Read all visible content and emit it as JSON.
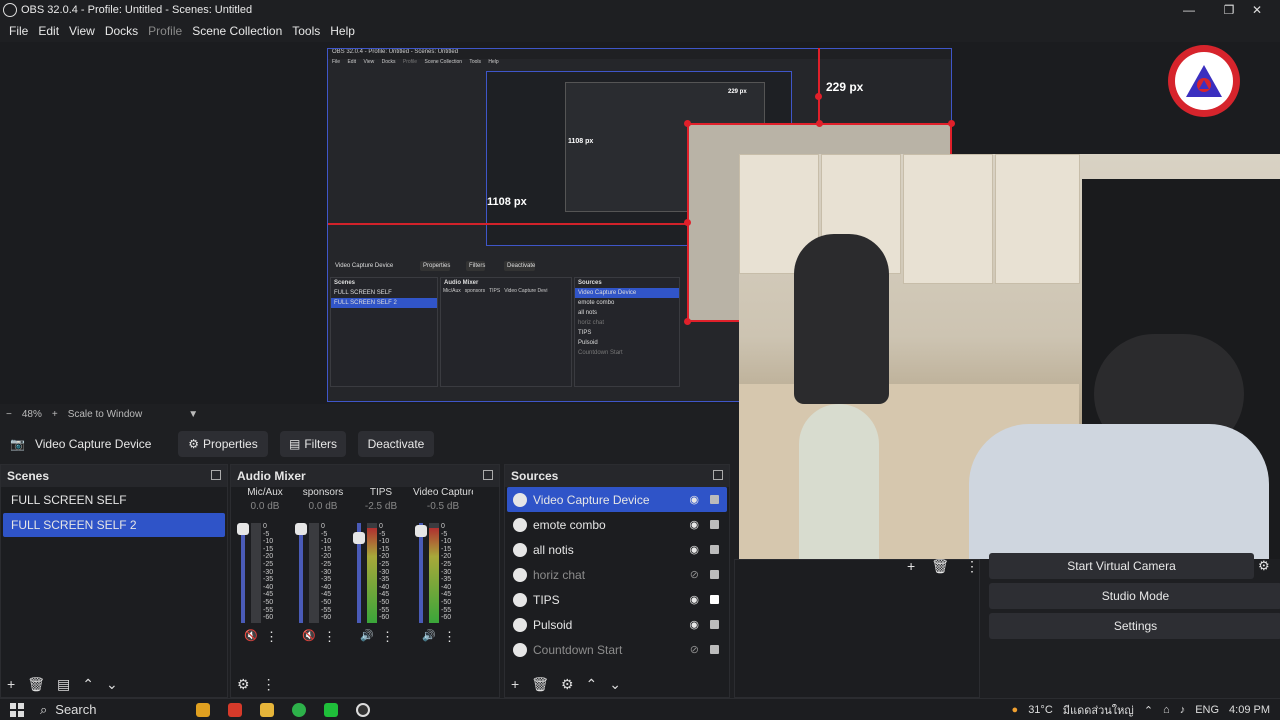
{
  "window": {
    "title": "OBS 32.0.4 - Profile: Untitled - Scenes: Untitled",
    "minimize": "—",
    "restore": "❐",
    "close": "✕"
  },
  "menu": [
    "File",
    "Edit",
    "View",
    "Docks",
    "Profile",
    "Scene Collection",
    "Tools",
    "Help"
  ],
  "preview": {
    "nested_title": "OBS 32.0.4 - Profile: Untitled - Scenes: Untitled",
    "nested_menu": [
      "File",
      "Edit",
      "View",
      "Docks",
      "Profile",
      "Scene Collection",
      "Tools",
      "Help"
    ],
    "measure_top": "229 px",
    "measure_left": "1108 px",
    "measure_inner_top": "229 px",
    "measure_inner_left": "1108 px",
    "nested_source_name": "Video Capture Device",
    "nested_buttons": [
      "Properties",
      "Filters",
      "Deactivate"
    ],
    "nested_scenes_title": "Scenes",
    "nested_scenes": [
      "FULL SCREEN SELF",
      "FULL SCREEN SELF 2"
    ],
    "nested_audio_title": "Audio Mixer",
    "nested_audio": [
      "Mic/Aux",
      "sponsors",
      "TIPS",
      "Video Capture Devi"
    ],
    "nested_sources_title": "Sources",
    "nested_sources": [
      "Video Capture Device",
      "emote combo",
      "all nots",
      "horiz chat",
      "TIPS",
      "Pulsoid",
      "Countdown Start"
    ]
  },
  "zoom": {
    "minus": "−",
    "value": "48%",
    "plus": "+",
    "mode": "Scale to Window"
  },
  "source_toolbar": {
    "name": "Video Capture Device",
    "properties": "Properties",
    "filters": "Filters",
    "deactivate": "Deactivate"
  },
  "scenes": {
    "title": "Scenes",
    "items": [
      "FULL SCREEN SELF",
      "FULL SCREEN SELF 2"
    ],
    "selected": 1
  },
  "audio_mixer": {
    "title": "Audio Mixer",
    "channels": [
      {
        "name": "Mic/Aux",
        "db": "0.0 dB",
        "fader_level": 1.0,
        "meter_level": 0.0,
        "muted": true
      },
      {
        "name": "sponsors",
        "db": "0.0 dB",
        "fader_level": 1.0,
        "meter_level": 0.0,
        "muted": true
      },
      {
        "name": "TIPS",
        "db": "-2.5 dB",
        "fader_level": 0.9,
        "meter_level": 0.95,
        "muted": false
      },
      {
        "name": "Video Capture Devi",
        "db": "-0.5 dB",
        "fader_level": 0.98,
        "meter_level": 0.95,
        "muted": false
      }
    ],
    "scale": [
      "0",
      "-5",
      "-10",
      "-15",
      "-20",
      "-25",
      "-30",
      "-35",
      "-40",
      "-45",
      "-50",
      "-55",
      "-60"
    ]
  },
  "sources": {
    "title": "Sources",
    "items": [
      {
        "name": "Video Capture Device",
        "visible": true,
        "locked": false
      },
      {
        "name": "emote combo",
        "visible": true,
        "locked": false
      },
      {
        "name": "all notis",
        "visible": true,
        "locked": false
      },
      {
        "name": "horiz chat",
        "visible": false,
        "locked": false
      },
      {
        "name": "TIPS",
        "visible": true,
        "locked": true
      },
      {
        "name": "Pulsoid",
        "visible": true,
        "locked": false
      },
      {
        "name": "Countdown Start",
        "visible": false,
        "locked": false
      }
    ],
    "selected": 0
  },
  "controls": {
    "virtual_camera": "Start Virtual Camera",
    "studio_mode": "Studio Mode",
    "settings": "Settings"
  },
  "taskbar": {
    "search": "Search",
    "temperature": "31°C",
    "weather": "มีแดดส่วนใหญ่",
    "lang": "ENG",
    "time": "4:09 PM"
  },
  "colors": {
    "accent": "#2f54c8",
    "measure_red": "#e0202a",
    "background": "#1e1f22"
  }
}
